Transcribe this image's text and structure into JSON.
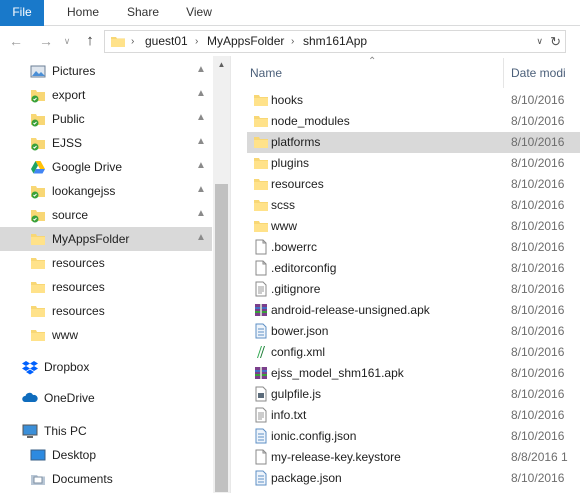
{
  "ribbon": {
    "tabs": [
      "File",
      "Home",
      "Share",
      "View"
    ]
  },
  "address": {
    "crumbs": [
      "guest01",
      "MyAppsFolder",
      "shm161App"
    ]
  },
  "nav_pane": {
    "items": [
      {
        "label": "Pictures",
        "icon": "pictures-icon",
        "pinned": true
      },
      {
        "label": "export",
        "icon": "folder-synced-icon",
        "pinned": true
      },
      {
        "label": "Public",
        "icon": "folder-synced-icon",
        "pinned": true
      },
      {
        "label": "EJSS",
        "icon": "folder-synced-icon",
        "pinned": true
      },
      {
        "label": "Google Drive",
        "icon": "google-drive-icon",
        "pinned": true
      },
      {
        "label": "lookangejss",
        "icon": "folder-synced-icon",
        "pinned": true
      },
      {
        "label": "source",
        "icon": "folder-synced-icon",
        "pinned": true
      },
      {
        "label": "MyAppsFolder",
        "icon": "folder-icon",
        "pinned": true,
        "selected": true
      },
      {
        "label": "resources",
        "icon": "folder-icon",
        "pinned": false
      },
      {
        "label": "resources",
        "icon": "folder-icon",
        "pinned": false
      },
      {
        "label": "resources",
        "icon": "folder-icon",
        "pinned": false
      },
      {
        "label": "www",
        "icon": "folder-icon",
        "pinned": false
      }
    ],
    "roots": [
      {
        "label": "Dropbox",
        "icon": "dropbox-icon"
      },
      {
        "label": "OneDrive",
        "icon": "onedrive-icon"
      },
      {
        "label": "This PC",
        "icon": "this-pc-icon"
      }
    ],
    "pc_items": [
      {
        "label": "Desktop",
        "icon": "desktop-icon"
      },
      {
        "label": "Documents",
        "icon": "documents-icon"
      }
    ]
  },
  "file_list": {
    "columns": {
      "name": "Name",
      "date": "Date modi"
    },
    "files": [
      {
        "name": "hooks",
        "date": "8/10/2016",
        "icon": "folder-icon"
      },
      {
        "name": "node_modules",
        "date": "8/10/2016",
        "icon": "folder-icon"
      },
      {
        "name": "platforms",
        "date": "8/10/2016",
        "icon": "folder-icon",
        "selected": true
      },
      {
        "name": "plugins",
        "date": "8/10/2016",
        "icon": "folder-icon"
      },
      {
        "name": "resources",
        "date": "8/10/2016",
        "icon": "folder-icon"
      },
      {
        "name": "scss",
        "date": "8/10/2016",
        "icon": "folder-icon"
      },
      {
        "name": "www",
        "date": "8/10/2016",
        "icon": "folder-icon"
      },
      {
        "name": ".bowerrc",
        "date": "8/10/2016",
        "icon": "file-icon"
      },
      {
        "name": ".editorconfig",
        "date": "8/10/2016",
        "icon": "file-icon"
      },
      {
        "name": ".gitignore",
        "date": "8/10/2016",
        "icon": "text-file-icon"
      },
      {
        "name": "android-release-unsigned.apk",
        "date": "8/10/2016",
        "icon": "archive-icon"
      },
      {
        "name": "bower.json",
        "date": "8/10/2016",
        "icon": "json-file-icon"
      },
      {
        "name": "config.xml",
        "date": "8/10/2016",
        "icon": "xml-file-icon"
      },
      {
        "name": "ejss_model_shm161.apk",
        "date": "8/10/2016",
        "icon": "archive-icon"
      },
      {
        "name": "gulpfile.js",
        "date": "8/10/2016",
        "icon": "js-file-icon"
      },
      {
        "name": "info.txt",
        "date": "8/10/2016",
        "icon": "text-file-icon"
      },
      {
        "name": "ionic.config.json",
        "date": "8/10/2016",
        "icon": "json-file-icon"
      },
      {
        "name": "my-release-key.keystore",
        "date": "8/8/2016 1",
        "icon": "file-icon"
      },
      {
        "name": "package.json",
        "date": "8/10/2016",
        "icon": "json-file-icon"
      }
    ]
  }
}
